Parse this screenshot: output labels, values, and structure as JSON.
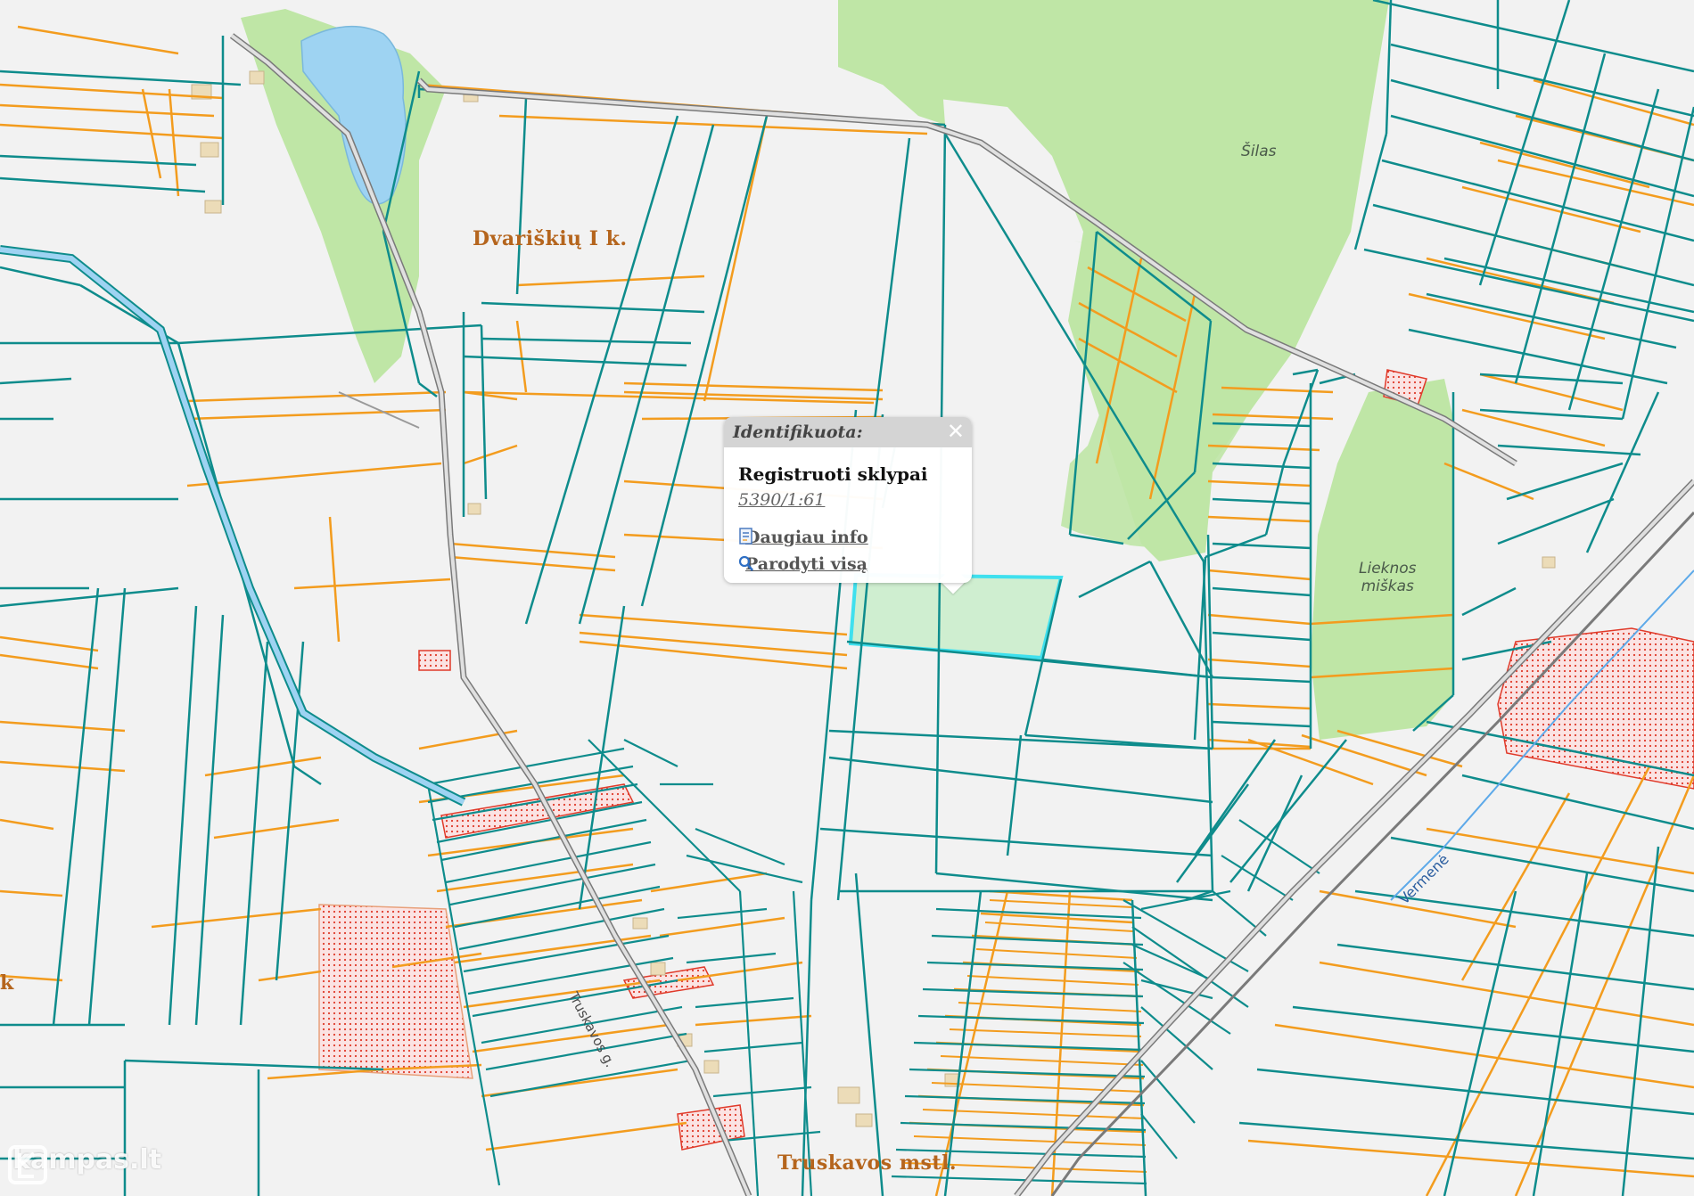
{
  "place_labels": {
    "village": "Dvariškių I k.",
    "town": "Truskavos mstl.",
    "edge": "k"
  },
  "forest_labels": {
    "silas": "Šilas",
    "lieknos": "Lieknos\nmiškas"
  },
  "road_label": "Truskavos g.",
  "river_label": "Vermenė",
  "popup": {
    "header": "Identifikuota:",
    "title": "Registruoti sklypai",
    "parcel_link": "5390/1:61",
    "actions": [
      {
        "label": "Daugiau info",
        "icon": "info-document-icon"
      },
      {
        "label": "Parodyti visą",
        "icon": "magnifier-icon"
      }
    ],
    "close_symbol": "✕"
  },
  "watermark": {
    "text": "kampas.lt",
    "icon": "kampas-logo-icon"
  },
  "colors": {
    "background": "#f2f2f2",
    "parcel_border_teal": "#0e8c8c",
    "parcel_border_orange": "#f39c1e",
    "forest_green": "#bfe6a6",
    "lake_blue": "#9ed3f2",
    "road_gray": "#9a9a9a",
    "selected_parcel": "#3fe0ee",
    "hatched_parcel": "#e03a2a",
    "place_label": "#b5651d"
  }
}
